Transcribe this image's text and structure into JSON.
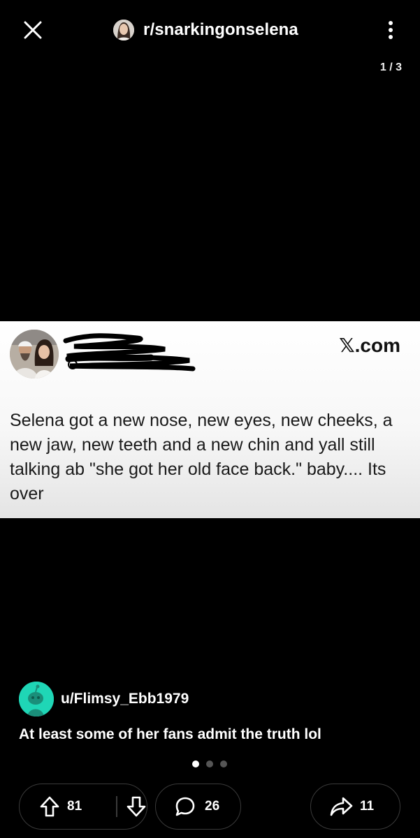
{
  "header": {
    "subreddit": "r/snarkingonselena",
    "image_counter": "1 / 3"
  },
  "embedded_post": {
    "source": ".com",
    "tweet_text": "Selena got a new nose, new eyes, new cheeks, a new jaw, new teeth and a new chin and yall still talking ab \"she got her old face back.\" baby.... Its over"
  },
  "post": {
    "author": "u/Flimsy_Ebb1979",
    "title": "At least some of her fans admit the truth lol"
  },
  "gallery": {
    "count": 3,
    "active_index": 0
  },
  "actions": {
    "upvotes": "81",
    "comments": "26",
    "shares": "11"
  },
  "colors": {
    "background": "#000000",
    "author_avatar": "#1fd6b6",
    "pill_border": "#3a3a3a"
  },
  "icons": [
    "close-icon",
    "more-vertical-icon",
    "x-logo-icon",
    "snoo-avatar-icon",
    "upvote-icon",
    "downvote-icon",
    "comment-icon",
    "share-icon"
  ]
}
